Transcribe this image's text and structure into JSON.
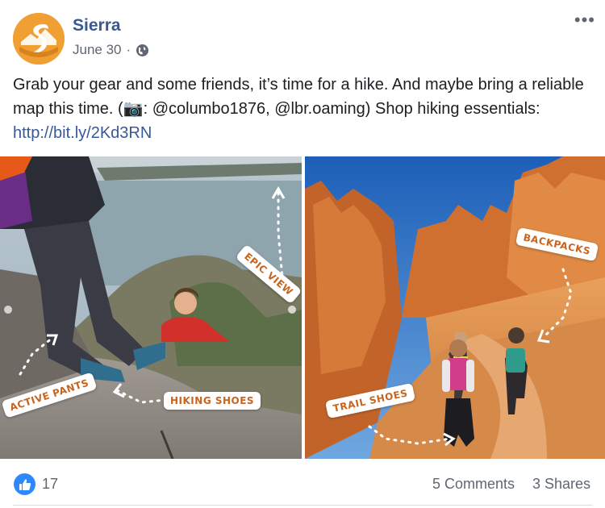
{
  "post": {
    "author": "Sierra",
    "date": "June 30",
    "separator": "·",
    "text_lead": "Grab your gear and some friends, it’s time for a hike. And maybe bring a reliable map this time. (📷: @columbo1876, @lbr.oaming) Shop hiking essentials: ",
    "link": "http://bit.ly/2Kd3RN",
    "more_icon": "more-options-icon",
    "privacy_icon": "globe-icon"
  },
  "photos": {
    "left_tags": {
      "epic_view": "EPIC VIEW",
      "active_pants": "ACTIVE PANTS",
      "hiking_shoes": "HIKING SHOES"
    },
    "right_tags": {
      "backpacks": "BACKPACKS",
      "trail_shoes": "TRAIL SHOES"
    }
  },
  "footer": {
    "like_count": "17",
    "comments": "5 Comments",
    "shares": "3 Shares"
  },
  "colors": {
    "brand_link": "#385898",
    "like_blue": "#2d88ff",
    "tag_orange": "#c8641e",
    "avatar_orange": "#f0a032"
  }
}
